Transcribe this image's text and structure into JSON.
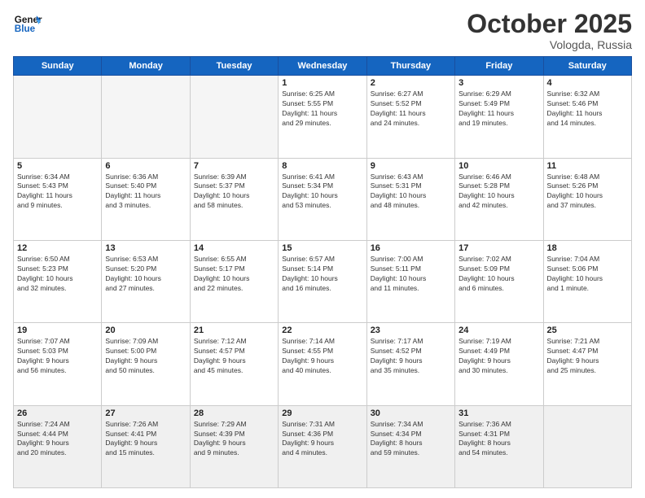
{
  "logo": {
    "line1": "General",
    "line2": "Blue"
  },
  "title": "October 2025",
  "location": "Vologda, Russia",
  "headers": [
    "Sunday",
    "Monday",
    "Tuesday",
    "Wednesday",
    "Thursday",
    "Friday",
    "Saturday"
  ],
  "weeks": [
    [
      {
        "day": "",
        "info": ""
      },
      {
        "day": "",
        "info": ""
      },
      {
        "day": "",
        "info": ""
      },
      {
        "day": "1",
        "info": "Sunrise: 6:25 AM\nSunset: 5:55 PM\nDaylight: 11 hours\nand 29 minutes."
      },
      {
        "day": "2",
        "info": "Sunrise: 6:27 AM\nSunset: 5:52 PM\nDaylight: 11 hours\nand 24 minutes."
      },
      {
        "day": "3",
        "info": "Sunrise: 6:29 AM\nSunset: 5:49 PM\nDaylight: 11 hours\nand 19 minutes."
      },
      {
        "day": "4",
        "info": "Sunrise: 6:32 AM\nSunset: 5:46 PM\nDaylight: 11 hours\nand 14 minutes."
      }
    ],
    [
      {
        "day": "5",
        "info": "Sunrise: 6:34 AM\nSunset: 5:43 PM\nDaylight: 11 hours\nand 9 minutes."
      },
      {
        "day": "6",
        "info": "Sunrise: 6:36 AM\nSunset: 5:40 PM\nDaylight: 11 hours\nand 3 minutes."
      },
      {
        "day": "7",
        "info": "Sunrise: 6:39 AM\nSunset: 5:37 PM\nDaylight: 10 hours\nand 58 minutes."
      },
      {
        "day": "8",
        "info": "Sunrise: 6:41 AM\nSunset: 5:34 PM\nDaylight: 10 hours\nand 53 minutes."
      },
      {
        "day": "9",
        "info": "Sunrise: 6:43 AM\nSunset: 5:31 PM\nDaylight: 10 hours\nand 48 minutes."
      },
      {
        "day": "10",
        "info": "Sunrise: 6:46 AM\nSunset: 5:28 PM\nDaylight: 10 hours\nand 42 minutes."
      },
      {
        "day": "11",
        "info": "Sunrise: 6:48 AM\nSunset: 5:26 PM\nDaylight: 10 hours\nand 37 minutes."
      }
    ],
    [
      {
        "day": "12",
        "info": "Sunrise: 6:50 AM\nSunset: 5:23 PM\nDaylight: 10 hours\nand 32 minutes."
      },
      {
        "day": "13",
        "info": "Sunrise: 6:53 AM\nSunset: 5:20 PM\nDaylight: 10 hours\nand 27 minutes."
      },
      {
        "day": "14",
        "info": "Sunrise: 6:55 AM\nSunset: 5:17 PM\nDaylight: 10 hours\nand 22 minutes."
      },
      {
        "day": "15",
        "info": "Sunrise: 6:57 AM\nSunset: 5:14 PM\nDaylight: 10 hours\nand 16 minutes."
      },
      {
        "day": "16",
        "info": "Sunrise: 7:00 AM\nSunset: 5:11 PM\nDaylight: 10 hours\nand 11 minutes."
      },
      {
        "day": "17",
        "info": "Sunrise: 7:02 AM\nSunset: 5:09 PM\nDaylight: 10 hours\nand 6 minutes."
      },
      {
        "day": "18",
        "info": "Sunrise: 7:04 AM\nSunset: 5:06 PM\nDaylight: 10 hours\nand 1 minute."
      }
    ],
    [
      {
        "day": "19",
        "info": "Sunrise: 7:07 AM\nSunset: 5:03 PM\nDaylight: 9 hours\nand 56 minutes."
      },
      {
        "day": "20",
        "info": "Sunrise: 7:09 AM\nSunset: 5:00 PM\nDaylight: 9 hours\nand 50 minutes."
      },
      {
        "day": "21",
        "info": "Sunrise: 7:12 AM\nSunset: 4:57 PM\nDaylight: 9 hours\nand 45 minutes."
      },
      {
        "day": "22",
        "info": "Sunrise: 7:14 AM\nSunset: 4:55 PM\nDaylight: 9 hours\nand 40 minutes."
      },
      {
        "day": "23",
        "info": "Sunrise: 7:17 AM\nSunset: 4:52 PM\nDaylight: 9 hours\nand 35 minutes."
      },
      {
        "day": "24",
        "info": "Sunrise: 7:19 AM\nSunset: 4:49 PM\nDaylight: 9 hours\nand 30 minutes."
      },
      {
        "day": "25",
        "info": "Sunrise: 7:21 AM\nSunset: 4:47 PM\nDaylight: 9 hours\nand 25 minutes."
      }
    ],
    [
      {
        "day": "26",
        "info": "Sunrise: 7:24 AM\nSunset: 4:44 PM\nDaylight: 9 hours\nand 20 minutes."
      },
      {
        "day": "27",
        "info": "Sunrise: 7:26 AM\nSunset: 4:41 PM\nDaylight: 9 hours\nand 15 minutes."
      },
      {
        "day": "28",
        "info": "Sunrise: 7:29 AM\nSunset: 4:39 PM\nDaylight: 9 hours\nand 9 minutes."
      },
      {
        "day": "29",
        "info": "Sunrise: 7:31 AM\nSunset: 4:36 PM\nDaylight: 9 hours\nand 4 minutes."
      },
      {
        "day": "30",
        "info": "Sunrise: 7:34 AM\nSunset: 4:34 PM\nDaylight: 8 hours\nand 59 minutes."
      },
      {
        "day": "31",
        "info": "Sunrise: 7:36 AM\nSunset: 4:31 PM\nDaylight: 8 hours\nand 54 minutes."
      },
      {
        "day": "",
        "info": ""
      }
    ]
  ]
}
